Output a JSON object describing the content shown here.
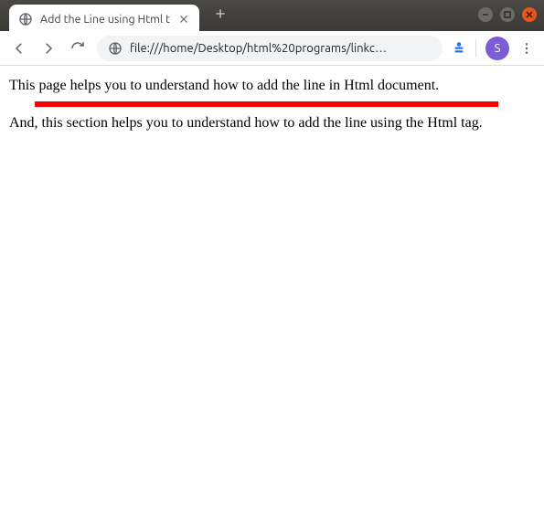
{
  "window": {
    "tab_title": "Add the Line using Html t"
  },
  "toolbar": {
    "url": "file:///home/Desktop/html%20programs/linkc…"
  },
  "avatar": {
    "initial": "S"
  },
  "content": {
    "paragraph1": "This page helps you to understand how to add the line in Html document.",
    "paragraph2": "And, this section helps you to understand how to add the line using the Html tag.",
    "hr_color": "red"
  }
}
